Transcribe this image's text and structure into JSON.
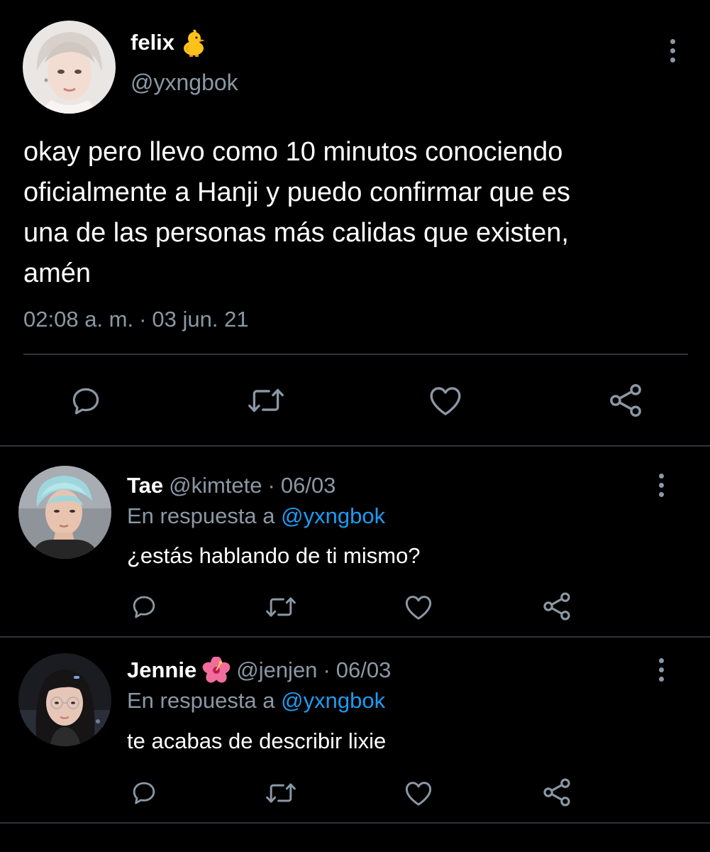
{
  "main_tweet": {
    "author": {
      "name": "felix",
      "emoji": "baby-chick",
      "handle": "@yxngbok"
    },
    "text": "okay pero llevo como 10 minutos conociendo\noficialmente a Hanji y puedo confirmar que es\nuna de las personas más calidas que existen,\namén",
    "time": "02:08 a. m.",
    "separator": "·",
    "date": "03 jun. 21",
    "actions": [
      "reply-icon",
      "retweet-icon",
      "like-icon",
      "share-icon"
    ]
  },
  "replies": [
    {
      "name": "Tae",
      "handle": "@kimtete",
      "separator": "·",
      "date": "06/03",
      "reply_prefix": "En respuesta a",
      "reply_to": "@yxngbok",
      "text": "¿estás hablando de ti mismo?"
    },
    {
      "name": "Jennie",
      "emoji": "hibiscus",
      "handle": "@jenjen",
      "separator": "·",
      "date": "06/03",
      "reply_prefix": "En respuesta a",
      "reply_to": "@yxngbok",
      "text": "te acabas de describir lixie"
    }
  ],
  "colors": {
    "background": "#000000",
    "text_primary": "#ffffff",
    "text_secondary": "#8b98a5",
    "mention": "#1d9bf0",
    "divider": "#2f3336",
    "icon": "#8b98a5"
  }
}
